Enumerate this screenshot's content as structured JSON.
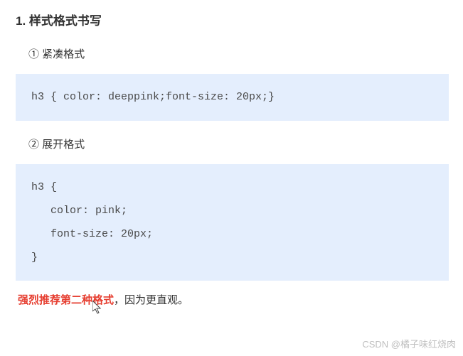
{
  "heading": "1. 样式格式书写",
  "section1": {
    "title": "① 紧凑格式",
    "code": "h3 { color: deeppink;font-size: 20px;}"
  },
  "section2": {
    "title": "② 展开格式",
    "code": "h3 {\n   color: pink;\n   font-size: 20px;\n}"
  },
  "recommendation": {
    "highlight": "强烈推荐第二种格式",
    "rest": "，因为更直观。"
  },
  "watermark": "CSDN @橘子味红烧肉"
}
